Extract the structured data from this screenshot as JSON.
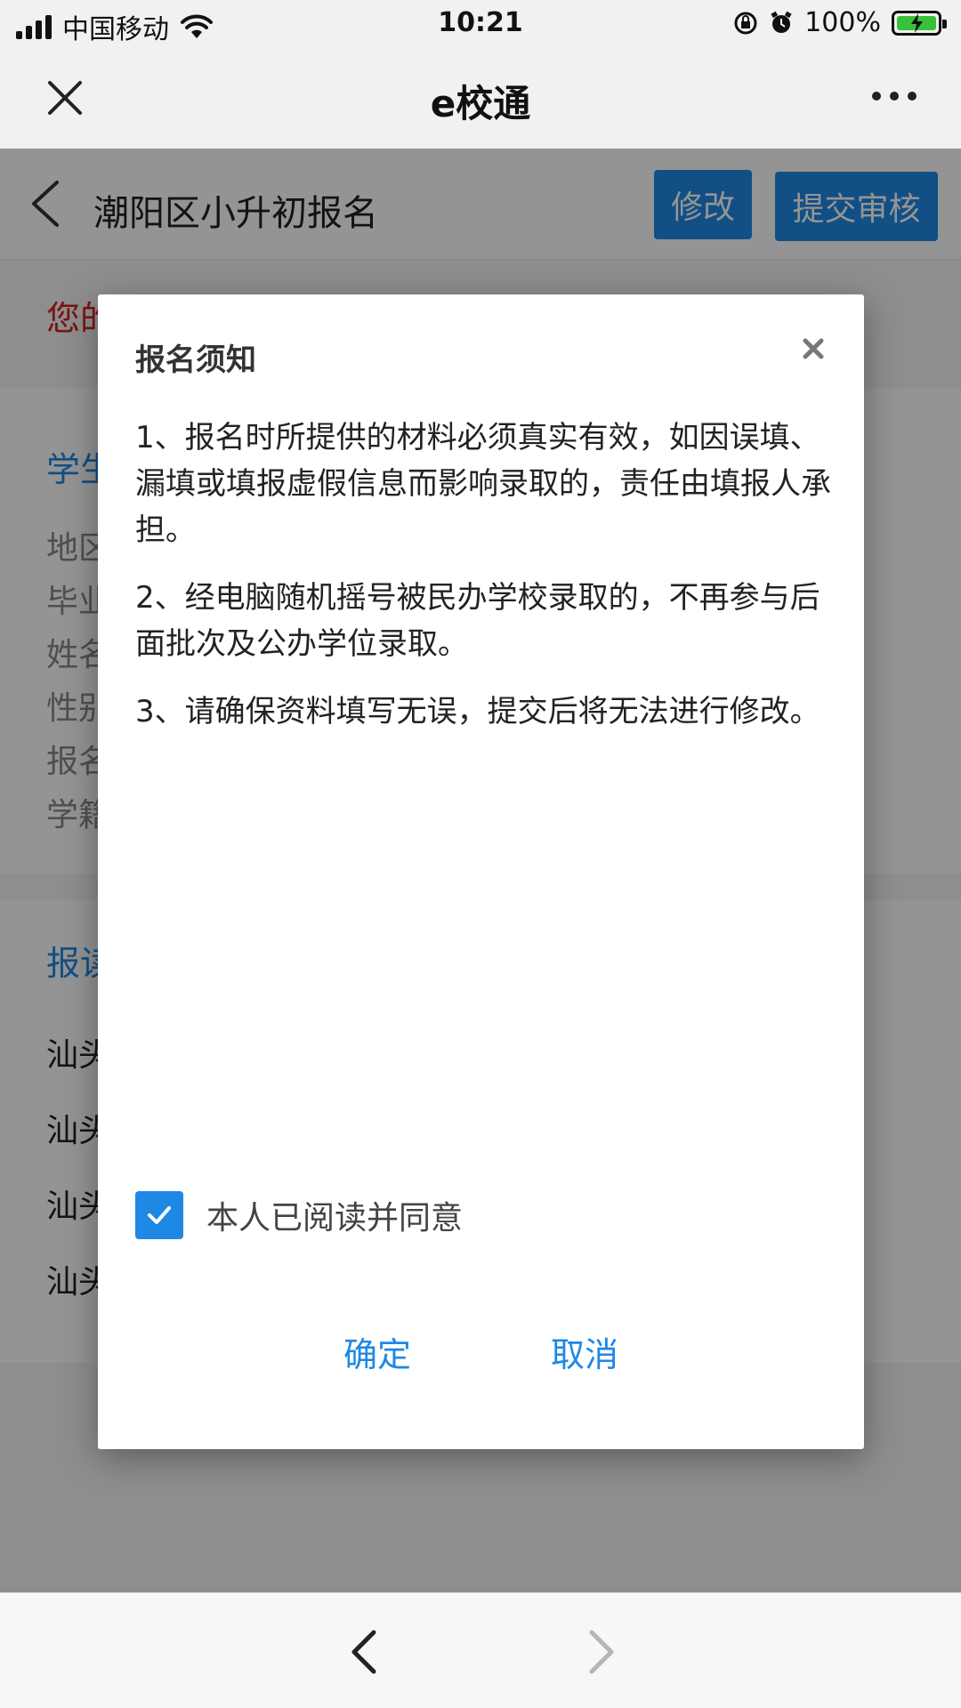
{
  "status_bar": {
    "carrier": "中国移动",
    "time": "10:21",
    "battery_percent": "100%",
    "battery_level": 1.0,
    "icons": [
      "signal-icon",
      "wifi-icon",
      "rotation-lock-icon",
      "alarm-icon",
      "battery-charging-icon"
    ]
  },
  "title_bar": {
    "title": "e校通",
    "icons": [
      "close-icon",
      "more-icon"
    ]
  },
  "page": {
    "title": "潮阳区小升初报名",
    "edit_label": "修改",
    "submit_label": "提交审核",
    "notice_prefix": "您的",
    "section1_title_prefix": "学生",
    "section1_rows": [
      "地区",
      "毕业",
      "姓名",
      "性别",
      "报名",
      "学籍"
    ],
    "section2_title_prefix": "报读",
    "section2_rows": [
      "汕头",
      "汕头",
      "汕头",
      "汕头"
    ]
  },
  "modal": {
    "title": "报名须知",
    "paragraphs": [
      "1、报名时所提供的材料必须真实有效，如因误填、漏填或填报虚假信息而影响录取的，责任由填报人承担。",
      "2、经电脑随机摇号被民办学校录取的，不再参与后面批次及公办学位录取。",
      "3、请确保资料填写无误，提交后将无法进行修改。"
    ],
    "agree_label": "本人已阅读并同意",
    "agree_checked": true,
    "confirm_label": "确定",
    "cancel_label": "取消"
  },
  "colors": {
    "accent": "#1e88e5",
    "alert": "#d62020",
    "battery": "#37c23a"
  }
}
